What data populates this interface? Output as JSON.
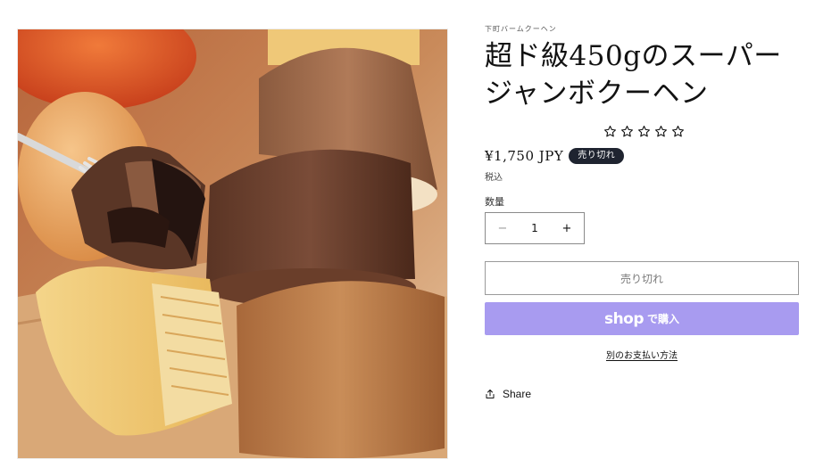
{
  "product": {
    "vendor": "下町バームクーヘン",
    "title_line1": "超ド級450gのスーパー",
    "title_line2": "ジャンボクーヘン",
    "rating_stars": 5,
    "rating_filled": 0,
    "price": "¥1,750 JPY",
    "badge": "売り切れ",
    "tax_note": "税込",
    "quantity_label": "数量",
    "quantity_value": "1",
    "quantity_minus": "−",
    "quantity_plus": "+",
    "soldout_button": "売り切れ",
    "shop_pay_brand": "shop",
    "shop_pay_suffix": "で購入",
    "more_payment": "別のお支払い方法",
    "share_label": "Share"
  },
  "colors": {
    "badge_bg": "#1f2430",
    "shop_pay_bg": "#a89bf0",
    "text": "#121212"
  },
  "icons": {
    "rating": "star-outline-icon",
    "share": "share-icon",
    "minus": "minus-icon",
    "plus": "plus-icon"
  }
}
